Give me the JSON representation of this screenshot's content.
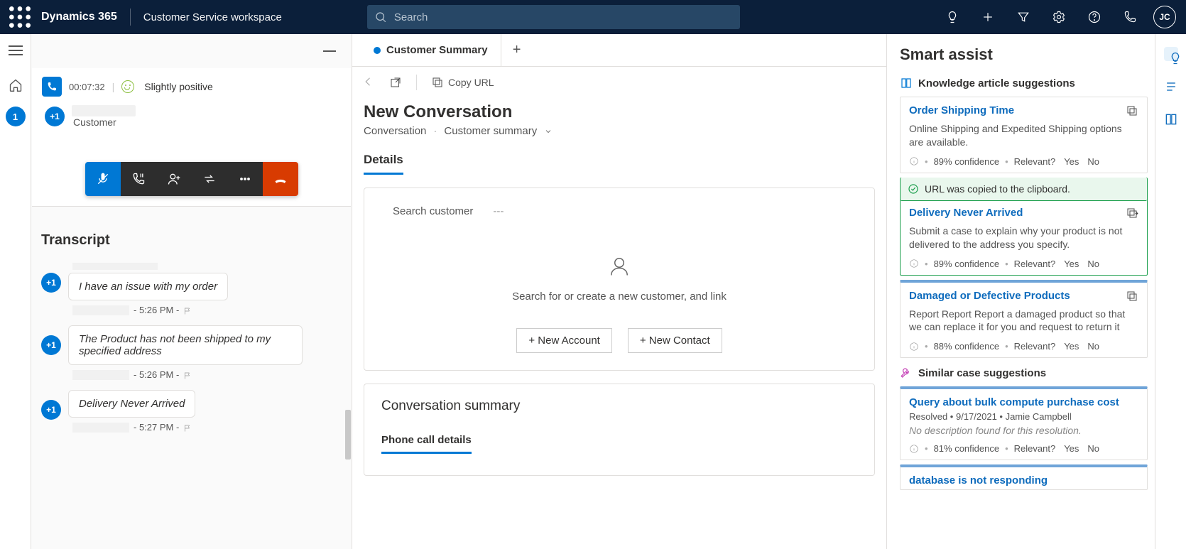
{
  "topbar": {
    "brand": "Dynamics 365",
    "workspace": "Customer Service workspace",
    "search_placeholder": "Search",
    "avatar_initials": "JC"
  },
  "left_rail": {
    "session_badge": "1"
  },
  "conversation": {
    "call_timer": "00:07:32",
    "sentiment_label": "Slightly positive",
    "customer_badge": "+1",
    "customer_label": "Customer",
    "transcript_title": "Transcript",
    "messages": [
      {
        "badge": "+1",
        "text": "I have an issue with my order",
        "time": "- 5:26 PM -"
      },
      {
        "badge": "+1",
        "text": "The Product has not been shipped to my specified address",
        "time": "- 5:26 PM -"
      },
      {
        "badge": "+1",
        "text": "Delivery Never Arrived",
        "time": "- 5:27 PM -"
      }
    ]
  },
  "main": {
    "tab_label": "Customer Summary",
    "copy_url_label": "Copy URL",
    "page_title": "New Conversation",
    "breadcrumb_a": "Conversation",
    "breadcrumb_b": "Customer summary",
    "details_tab": "Details",
    "search_customer_label": "Search customer",
    "search_customer_value": "---",
    "empty_text": "Search for or create a new customer, and link",
    "btn_new_account": "+ New Account",
    "btn_new_contact": "+ New Contact",
    "conv_summary_title": "Conversation summary",
    "phone_details_tab": "Phone call details"
  },
  "assist": {
    "title": "Smart assist",
    "kb_header": "Knowledge article suggestions",
    "cards": [
      {
        "title": "Order Shipping Time",
        "desc": "Online Shipping and Expedited Shipping options are available.",
        "confidence": "89% confidence",
        "relevant": "Relevant?",
        "yes": "Yes",
        "no": "No"
      },
      {
        "title": "Delivery Never Arrived",
        "desc": "Submit a case to explain why your product is not delivered to the address you specify.",
        "confidence": "89% confidence",
        "relevant": "Relevant?",
        "yes": "Yes",
        "no": "No"
      },
      {
        "title": "Damaged or Defective Products",
        "desc": "Report Report Report a damaged product so that we can replace it for you and request to return it",
        "confidence": "88% confidence",
        "relevant": "Relevant?",
        "yes": "Yes",
        "no": "No"
      }
    ],
    "copied_banner": "URL was copied to the clipboard.",
    "similar_header": "Similar case suggestions",
    "cases": [
      {
        "title": "Query about bulk compute purchase cost",
        "meta": "Resolved • 9/17/2021 • Jamie Campbell",
        "nores": "No description found for this resolution.",
        "confidence": "81% confidence",
        "relevant": "Relevant?",
        "yes": "Yes",
        "no": "No"
      },
      {
        "title": "database is not responding"
      }
    ]
  }
}
